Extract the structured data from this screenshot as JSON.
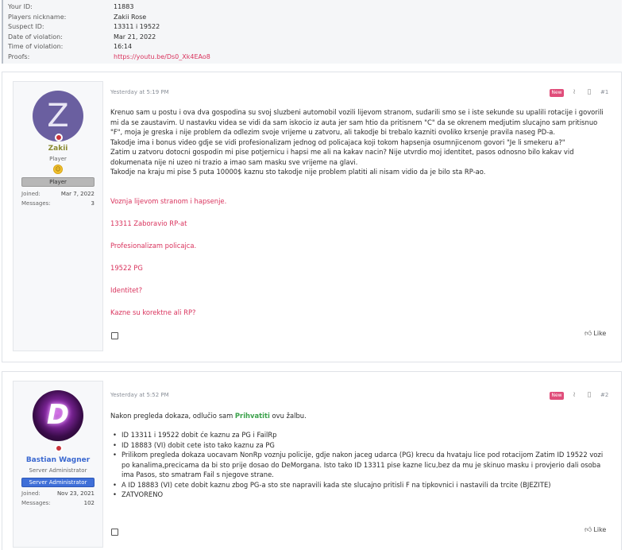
{
  "quote": {
    "rows": [
      {
        "label": "Your ID:",
        "value": "11883"
      },
      {
        "label": "Players nickname:",
        "value": "Zakii Rose"
      },
      {
        "label": "Suspect ID:",
        "value": "13311 i 19522"
      },
      {
        "label": "Date of violation:",
        "value": "Mar 21, 2022"
      },
      {
        "label": "Time of violation:",
        "value": "16:14"
      },
      {
        "label": "Proofs:",
        "value": "https://youtu.be/Ds0_Xk4EAo8"
      }
    ]
  },
  "post1": {
    "user": {
      "avatar_letter": "Z",
      "name": "Zakii",
      "title": "Player",
      "role": "Player",
      "joined_label": "Joined:",
      "joined": "Mar 7, 2022",
      "messages_label": "Messages:",
      "messages": "3"
    },
    "time": "Yesterday at 5:19 PM",
    "new_label": "New",
    "number": "#1",
    "paragraph": [
      "Krenuo sam u postu i ova dva gospodina su svoj sluzbeni automobil vozili lijevom stranom, sudarili smo se i iste sekunde su upalili rotacije i govorili mi da se zaustavim. U nastavku videa se vidi da sam iskocio iz auta jer sam htio da pritisnem \"C\" da se okrenem medjutim slucajno sam pritisnuo \"F\", moja je greska i nije problem da odlezim svoje vrijeme u zatvoru, ali takodje bi trebalo kazniti ovoliko krsenje pravila naseg PD-a.",
      "Takodje ima i bonus video gdje se vidi profesionalizam jednog od policajaca koji tokom hapsenja osumnjicenom govori \"Je li smekeru a?\"",
      "Zatim u zatvoru dotocni gospodin mi pise potjernicu i hapsi me ali na kakav nacin? Nije utvrdio moj identitet, pasos odnosno bilo kakav vid dokumenata nije ni uzeo ni trazio a imao sam masku sve vrijeme na glavi.",
      "Takodje na kraju mi pise 5 puta 10000$ kaznu sto takodje nije problem platiti ali nisam vidio da je bilo sta RP-ao."
    ],
    "links": [
      "Voznja lijevom stranom i hapsenje.",
      "13311 Zaboravio RP-at",
      "Profesionalizam policajca.",
      "19522 PG",
      "Identitet?",
      "Kazne su korektne ali RP?"
    ],
    "like": "Like"
  },
  "post2": {
    "user": {
      "name": "Bastian Wagner",
      "title": "Server Administrator",
      "role": "Server Administrator",
      "joined_label": "Joined:",
      "joined": "Nov 23, 2021",
      "messages_label": "Messages:",
      "messages": "102"
    },
    "time": "Yesterday at 5:52 PM",
    "new_label": "New",
    "number": "#2",
    "intro_before": "Nakon pregleda dokaza, odlučio sam ",
    "intro_highlight": "Prihvatiti",
    "intro_after": " ovu žalbu.",
    "bullets": [
      "ID 13311 i 19522 dobit će kaznu za PG i FailRp",
      "ID 18883 (VI) dobit cete isto tako kaznu za PG",
      "Prilikom pregleda dokaza uocavam NonRp voznju policije, gdje nakon jaceg udarca (PG) krecu da hvataju lice pod rotacijom Zatim ID 19522 vozi po kanalima,precicama da bi sto prije dosao do DeMorgana. Isto tako ID 13311 pise kazne licu,bez da mu je skinuo masku i provjerio dali osoba ima Pasos, sto smatram Fail s njegove strane.",
      "A ID 18883 (VI) cete dobit kaznu zbog PG-a sto ste napravili kada ste slucajno pritisli F na tipkovnici i nastavili da trcite (BJEZITE)",
      "ZATVORENO"
    ],
    "like": "Like"
  },
  "colors": {
    "accent_pink": "#d9335d",
    "green": "#3aa14a",
    "admin_blue": "#3f6fd8"
  }
}
